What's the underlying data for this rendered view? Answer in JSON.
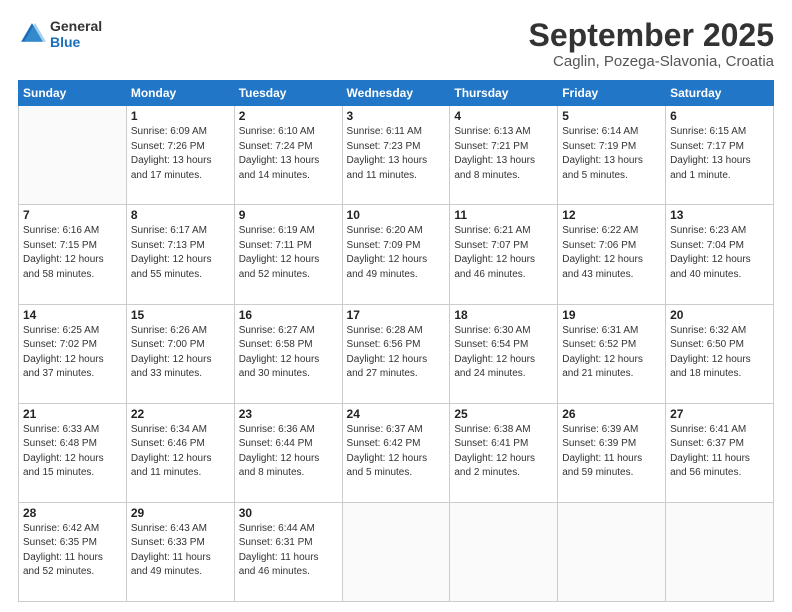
{
  "logo": {
    "line1": "General",
    "line2": "Blue"
  },
  "title": "September 2025",
  "subtitle": "Caglin, Pozega-Slavonia, Croatia",
  "days_of_week": [
    "Sunday",
    "Monday",
    "Tuesday",
    "Wednesday",
    "Thursday",
    "Friday",
    "Saturday"
  ],
  "weeks": [
    [
      {
        "day": "",
        "info": ""
      },
      {
        "day": "1",
        "info": "Sunrise: 6:09 AM\nSunset: 7:26 PM\nDaylight: 13 hours\nand 17 minutes."
      },
      {
        "day": "2",
        "info": "Sunrise: 6:10 AM\nSunset: 7:24 PM\nDaylight: 13 hours\nand 14 minutes."
      },
      {
        "day": "3",
        "info": "Sunrise: 6:11 AM\nSunset: 7:23 PM\nDaylight: 13 hours\nand 11 minutes."
      },
      {
        "day": "4",
        "info": "Sunrise: 6:13 AM\nSunset: 7:21 PM\nDaylight: 13 hours\nand 8 minutes."
      },
      {
        "day": "5",
        "info": "Sunrise: 6:14 AM\nSunset: 7:19 PM\nDaylight: 13 hours\nand 5 minutes."
      },
      {
        "day": "6",
        "info": "Sunrise: 6:15 AM\nSunset: 7:17 PM\nDaylight: 13 hours\nand 1 minute."
      }
    ],
    [
      {
        "day": "7",
        "info": "Sunrise: 6:16 AM\nSunset: 7:15 PM\nDaylight: 12 hours\nand 58 minutes."
      },
      {
        "day": "8",
        "info": "Sunrise: 6:17 AM\nSunset: 7:13 PM\nDaylight: 12 hours\nand 55 minutes."
      },
      {
        "day": "9",
        "info": "Sunrise: 6:19 AM\nSunset: 7:11 PM\nDaylight: 12 hours\nand 52 minutes."
      },
      {
        "day": "10",
        "info": "Sunrise: 6:20 AM\nSunset: 7:09 PM\nDaylight: 12 hours\nand 49 minutes."
      },
      {
        "day": "11",
        "info": "Sunrise: 6:21 AM\nSunset: 7:07 PM\nDaylight: 12 hours\nand 46 minutes."
      },
      {
        "day": "12",
        "info": "Sunrise: 6:22 AM\nSunset: 7:06 PM\nDaylight: 12 hours\nand 43 minutes."
      },
      {
        "day": "13",
        "info": "Sunrise: 6:23 AM\nSunset: 7:04 PM\nDaylight: 12 hours\nand 40 minutes."
      }
    ],
    [
      {
        "day": "14",
        "info": "Sunrise: 6:25 AM\nSunset: 7:02 PM\nDaylight: 12 hours\nand 37 minutes."
      },
      {
        "day": "15",
        "info": "Sunrise: 6:26 AM\nSunset: 7:00 PM\nDaylight: 12 hours\nand 33 minutes."
      },
      {
        "day": "16",
        "info": "Sunrise: 6:27 AM\nSunset: 6:58 PM\nDaylight: 12 hours\nand 30 minutes."
      },
      {
        "day": "17",
        "info": "Sunrise: 6:28 AM\nSunset: 6:56 PM\nDaylight: 12 hours\nand 27 minutes."
      },
      {
        "day": "18",
        "info": "Sunrise: 6:30 AM\nSunset: 6:54 PM\nDaylight: 12 hours\nand 24 minutes."
      },
      {
        "day": "19",
        "info": "Sunrise: 6:31 AM\nSunset: 6:52 PM\nDaylight: 12 hours\nand 21 minutes."
      },
      {
        "day": "20",
        "info": "Sunrise: 6:32 AM\nSunset: 6:50 PM\nDaylight: 12 hours\nand 18 minutes."
      }
    ],
    [
      {
        "day": "21",
        "info": "Sunrise: 6:33 AM\nSunset: 6:48 PM\nDaylight: 12 hours\nand 15 minutes."
      },
      {
        "day": "22",
        "info": "Sunrise: 6:34 AM\nSunset: 6:46 PM\nDaylight: 12 hours\nand 11 minutes."
      },
      {
        "day": "23",
        "info": "Sunrise: 6:36 AM\nSunset: 6:44 PM\nDaylight: 12 hours\nand 8 minutes."
      },
      {
        "day": "24",
        "info": "Sunrise: 6:37 AM\nSunset: 6:42 PM\nDaylight: 12 hours\nand 5 minutes."
      },
      {
        "day": "25",
        "info": "Sunrise: 6:38 AM\nSunset: 6:41 PM\nDaylight: 12 hours\nand 2 minutes."
      },
      {
        "day": "26",
        "info": "Sunrise: 6:39 AM\nSunset: 6:39 PM\nDaylight: 11 hours\nand 59 minutes."
      },
      {
        "day": "27",
        "info": "Sunrise: 6:41 AM\nSunset: 6:37 PM\nDaylight: 11 hours\nand 56 minutes."
      }
    ],
    [
      {
        "day": "28",
        "info": "Sunrise: 6:42 AM\nSunset: 6:35 PM\nDaylight: 11 hours\nand 52 minutes."
      },
      {
        "day": "29",
        "info": "Sunrise: 6:43 AM\nSunset: 6:33 PM\nDaylight: 11 hours\nand 49 minutes."
      },
      {
        "day": "30",
        "info": "Sunrise: 6:44 AM\nSunset: 6:31 PM\nDaylight: 11 hours\nand 46 minutes."
      },
      {
        "day": "",
        "info": ""
      },
      {
        "day": "",
        "info": ""
      },
      {
        "day": "",
        "info": ""
      },
      {
        "day": "",
        "info": ""
      }
    ]
  ]
}
